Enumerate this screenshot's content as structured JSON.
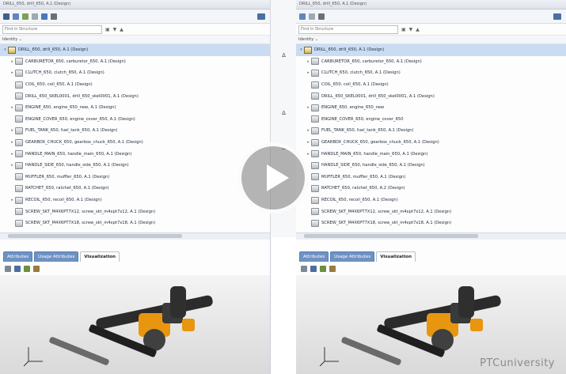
{
  "left": {
    "title": "DRILL_650, drill_650, A.1 (Design)",
    "find_placeholder": "Find in Structure",
    "column_header": "Identity ⌄",
    "tree_items": [
      {
        "label": "DRILL_650, drill_650, A.1 (Design)",
        "root": true,
        "expander": "▾"
      },
      {
        "label": "CARBURETOR_650, carburetor_650, A.1 (Design)",
        "expander": "▸"
      },
      {
        "label": "CLUTCH_650, clutch_650, A.1 (Design)",
        "expander": "▸"
      },
      {
        "label": "COIL_650, coil_650, A.1 (Design)",
        "expander": ""
      },
      {
        "label": "DRILL_650_SKEL0001, drill_650_skel0001, A.1 (Design)",
        "expander": ""
      },
      {
        "label": "ENGINE_650, engine_650_new, A.1 (Design)",
        "expander": "▸"
      },
      {
        "label": "ENGINE_COVER_650, engine_cover_650, A.1 (Design)",
        "expander": ""
      },
      {
        "label": "FUEL_TANK_650, fuel_tank_650, A.1 (Design)",
        "expander": "▸"
      },
      {
        "label": "GEARBOX_CHUCK_650, gearbox_chuck_650, A.1 (Design)",
        "expander": "▸"
      },
      {
        "label": "HANDLE_MAIN_650, handle_main_650, A.1 (Design)",
        "expander": "▸"
      },
      {
        "label": "HANDLE_SIDE_650, handle_side_650, A.1 (Design)",
        "expander": "▸"
      },
      {
        "label": "MUFFLER_650, muffler_650, A.1 (Design)",
        "expander": ""
      },
      {
        "label": "RATCHET_650, ratchet_650, A.1 (Design)",
        "expander": ""
      },
      {
        "label": "RECOIL_650, recoil_650, A.1 (Design)",
        "expander": "▸"
      },
      {
        "label": "SCREW_SKT_M4X6PT7X12, screw_skt_m4xpt7x12, A.1 (Design)",
        "expander": ""
      },
      {
        "label": "SCREW_SKT_M4X6PT7X18, screw_skt_m4xpt7x18, A.1 (Design)",
        "expander": ""
      }
    ],
    "tabs": [
      "Attributes",
      "Usage Attributes",
      "Visualization"
    ]
  },
  "right": {
    "title": "DRILL_650, drill_650, A.1 (Design)",
    "find_placeholder": "Find in Structure",
    "column_header": "Identity ⌄",
    "tree_items": [
      {
        "label": "DRILL_650, drill_650, A.1 (Design)",
        "root": true,
        "expander": "▾"
      },
      {
        "label": "CARBURETOR_650, carburetor_650, A.1 (Design)",
        "expander": "▸"
      },
      {
        "label": "CLUTCH_650, clutch_650, A.1 (Design)",
        "expander": "▸"
      },
      {
        "label": "COIL_650, coil_650, A.1 (Design)",
        "expander": ""
      },
      {
        "label": "DRILL_650_SKEL0001, drill_650_skel0001, A.1 (Design)",
        "expander": ""
      },
      {
        "label": "ENGINE_650, engine_650_new",
        "expander": "▸"
      },
      {
        "label": "ENGINE_COVER_650, engine_cover_650",
        "expander": ""
      },
      {
        "label": "FUEL_TANK_650, fuel_tank_650, A.1 (Design)",
        "expander": "▸"
      },
      {
        "label": "GEARBOX_CHUCK_650, gearbox_chuck_650, A.1 (Design)",
        "expander": "▸"
      },
      {
        "label": "HANDLE_MAIN_650, handle_main_650, A.1 (Design)",
        "expander": "▸"
      },
      {
        "label": "HANDLE_SIDE_650, handle_side_650, A.1 (Design)",
        "expander": ""
      },
      {
        "label": "MUFFLER_650, muffler_650, A.1 (Design)",
        "expander": ""
      },
      {
        "label": "RATCHET_650, ratchet_650, A.2 (Design)",
        "expander": ""
      },
      {
        "label": "RECOIL_650, recoil_650, A.1 (Design)",
        "expander": ""
      },
      {
        "label": "SCREW_SKT_M4X6PT7X12, screw_skt_m4xpt7x12, A.1 (Design)",
        "expander": ""
      },
      {
        "label": "SCREW_SKT_M4X6PT7X18, screw_skt_m4xpt7x18, A.1 (Design)",
        "expander": ""
      }
    ],
    "tabs": [
      "Attributes",
      "Usage Attributes",
      "Visualization"
    ]
  },
  "compare_marks": [
    "Δ",
    "Δ",
    "Δ"
  ],
  "watermark": "PTCuniversity",
  "colors": {
    "selection": "#c9dcf2",
    "tab_inactive": "#6e92c4",
    "accent_orange": "#e8960f"
  }
}
